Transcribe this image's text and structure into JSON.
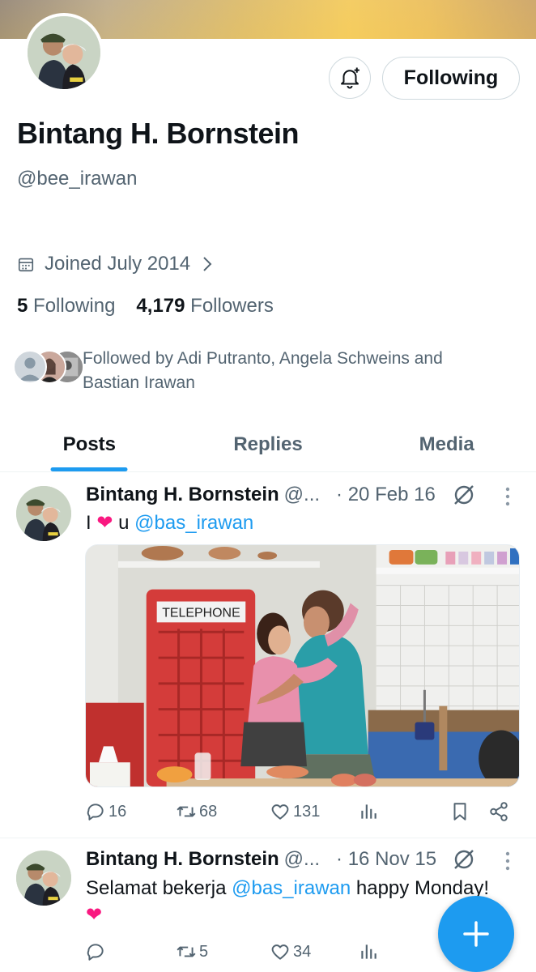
{
  "profile": {
    "name": "Bintang H. Bornstein",
    "handle": "@bee_irawan",
    "joined": "Joined July 2014",
    "following_count": "5",
    "following_label": "Following",
    "followers_count": "4,179",
    "followers_label": "Followers",
    "followed_by": "Followed by Adi Putranto, Angela Schweins and Bastian Irawan"
  },
  "buttons": {
    "following": "Following"
  },
  "tabs": [
    {
      "label": "Posts",
      "active": true
    },
    {
      "label": "Replies",
      "active": false
    },
    {
      "label": "Media",
      "active": false
    }
  ],
  "posts": [
    {
      "name": "Bintang H. Bornstein",
      "handle": "@...",
      "date": "· 20 Feb 16",
      "text_pre": "I",
      "text_mid": "u",
      "mention": "@bas_irawan",
      "media_text": "TELEPHONE",
      "replies": "16",
      "reposts": "68",
      "likes": "131"
    },
    {
      "name": "Bintang H. Bornstein",
      "handle": "@...",
      "date": "· 16 Nov 15",
      "text_pre": "Selamat bekerja",
      "mention": "@bas_irawan",
      "text_post": "happy Monday!",
      "replies": "",
      "reposts": "5",
      "likes": "34"
    }
  ],
  "colors": {
    "accent": "#1d9bf0",
    "heart": "#f91880",
    "muted": "#536471"
  }
}
